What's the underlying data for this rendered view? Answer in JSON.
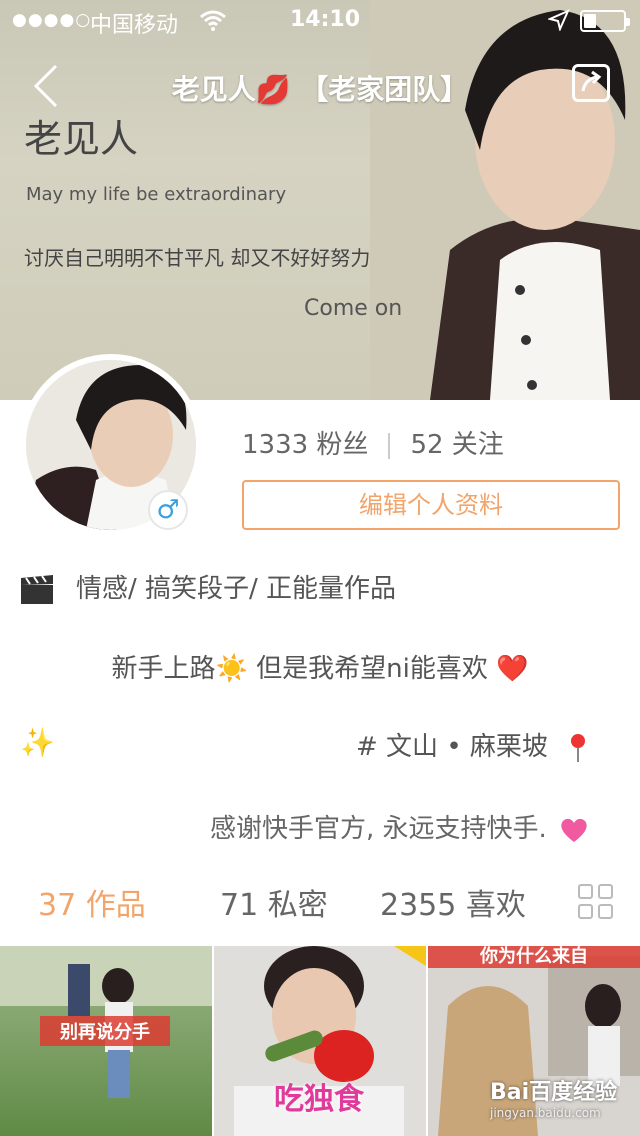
{
  "status_bar": {
    "carrier": "中国移动",
    "time": "14:10"
  },
  "nav": {
    "title": "老见人💋 【老家团队】"
  },
  "cover": {
    "line1": "老见人",
    "line2": "May my life be extraordinary",
    "line3": "讨厌自己明明不甘平凡 却又不好好努力",
    "line4": "Come on"
  },
  "profile": {
    "followers": "1333 粉丝",
    "following": "52 关注",
    "edit_button": "编辑个人资料",
    "tags": "情感/  搞笑段子/  正能量作品",
    "bio_line1": "新手上路☀️ 但是我希望ni能喜欢 ❤️",
    "sparkle": "✨",
    "location": "# 文山 • 麻栗坡",
    "bio_line3": "感谢快手官方, 永远支持快手."
  },
  "tabs": {
    "works": "37 作品",
    "private": "71 私密",
    "likes": "2355 喜欢"
  },
  "thumbnails": [
    {
      "caption": "别再说分手"
    },
    {
      "caption": "吃独食"
    },
    {
      "caption": "你为什么来自"
    }
  ],
  "watermark": {
    "brand": "Bai百度经验",
    "url": "jingyan.baidu.com"
  },
  "colors": {
    "accent": "#f2a46b",
    "text": "#555555"
  }
}
